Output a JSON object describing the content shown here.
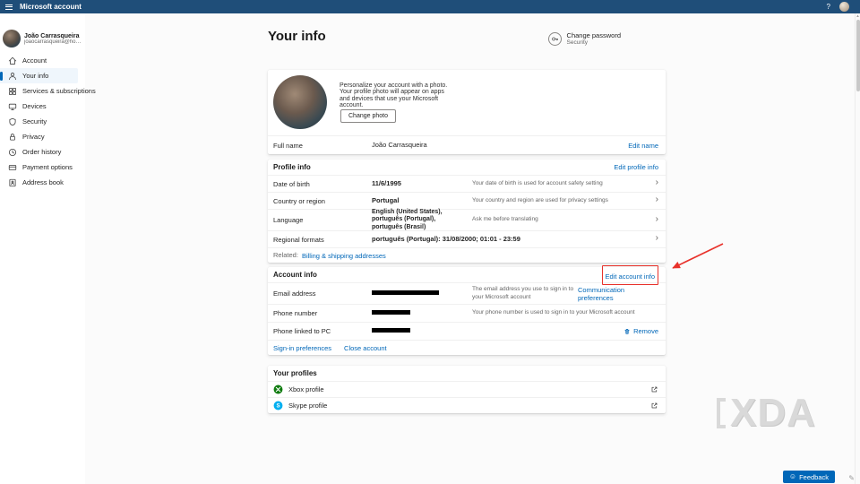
{
  "colors": {
    "accent": "#0067b8",
    "header_bg": "#1f4e79",
    "annotation_red": "#e8312a",
    "xbox_green": "#107c10",
    "skype_blue": "#00aff0",
    "redaction": "#000000"
  },
  "header": {
    "title": "Microsoft account",
    "help_label": "?"
  },
  "sidebar": {
    "user": {
      "name": "João Carrasqueira",
      "email": "joaocarrasqueira@hotmail.c..."
    },
    "items": [
      {
        "label": "Account",
        "icon": "home-icon"
      },
      {
        "label": "Your info",
        "icon": "person-icon",
        "selected": true
      },
      {
        "label": "Services & subscriptions",
        "icon": "apps-grid-icon"
      },
      {
        "label": "Devices",
        "icon": "devices-icon"
      },
      {
        "label": "Security",
        "icon": "shield-icon"
      },
      {
        "label": "Privacy",
        "icon": "lock-icon"
      },
      {
        "label": "Order history",
        "icon": "clock-icon"
      },
      {
        "label": "Payment options",
        "icon": "credit-card-icon"
      },
      {
        "label": "Address book",
        "icon": "contact-book-icon"
      }
    ]
  },
  "main": {
    "page_title": "Your info",
    "change_password": {
      "title": "Change password",
      "subtitle": "Security"
    },
    "photo_card": {
      "description": "Personalize your account with a photo. Your profile photo will appear on apps and devices that use your Microsoft account.",
      "change_photo_button": "Change photo",
      "full_name_label": "Full name",
      "full_name_value": "João Carrasqueira",
      "edit_name_link": "Edit name"
    },
    "profile_info": {
      "title": "Profile info",
      "edit_link": "Edit profile info",
      "rows": [
        {
          "label": "Date of birth",
          "value": "11/6/1995",
          "note": "Your date of birth is used for account safety setting"
        },
        {
          "label": "Country or region",
          "value": "Portugal",
          "note": "Your country and region are used for privacy settings"
        },
        {
          "label": "Language",
          "value": "English (United States), português (Portugal), português (Brasil)",
          "note": "Ask me before translating"
        },
        {
          "label": "Regional formats",
          "value": "português (Portugal): 31/08/2000; 01:01 - 23:59",
          "note": ""
        }
      ],
      "related_label": "Related:",
      "related_link": "Billing & shipping addresses"
    },
    "account_info": {
      "title": "Account info",
      "edit_link": "Edit account info",
      "email_row": {
        "label": "Email address",
        "note": "The email address you use to sign in to your Microsoft account",
        "action": "Communication preferences"
      },
      "phone_row": {
        "label": "Phone number",
        "note": "Your phone number is used to sign in to your Microsoft account"
      },
      "pc_row": {
        "label": "Phone linked to PC",
        "action": "Remove"
      },
      "signin_link": "Sign-in preferences",
      "close_link": "Close account"
    },
    "profiles": {
      "title": "Your profiles",
      "items": [
        {
          "label": "Xbox profile",
          "icon": "xbox-icon"
        },
        {
          "label": "Skype profile",
          "icon": "skype-icon"
        }
      ]
    }
  },
  "feedback": {
    "label": "Feedback"
  },
  "watermark": {
    "text": "XDA"
  }
}
